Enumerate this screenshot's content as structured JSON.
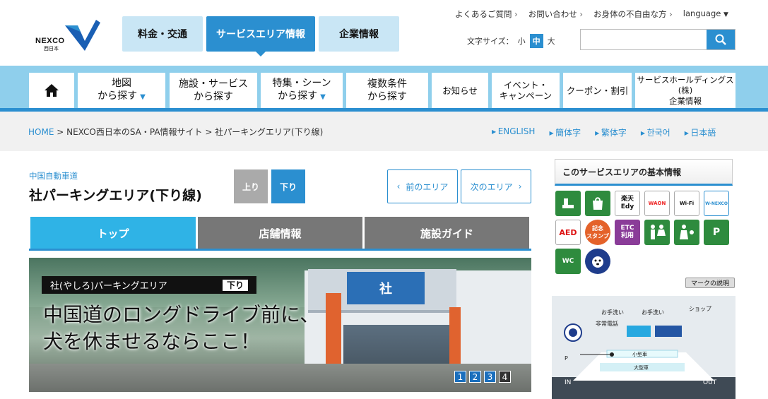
{
  "logo": {
    "brand": "NEXCO",
    "sub": "西日本"
  },
  "global_tabs": [
    "料金・交通",
    "サービスエリア情報",
    "企業情報"
  ],
  "utility_links": [
    "よくあるご質問",
    "お問い合わせ",
    "お身体の不自由な方"
  ],
  "language_label": "language",
  "font_size": {
    "label": "文字サイズ：",
    "small": "小",
    "medium": "中",
    "large": "大"
  },
  "search": {
    "placeholder": ""
  },
  "nav": {
    "map": [
      "地図",
      "から探す"
    ],
    "facility": [
      "施設・サービス",
      "から探す"
    ],
    "feature": [
      "特集・シーン",
      "から探す"
    ],
    "multi": [
      "複数条件",
      "から探す"
    ],
    "news": "お知らせ",
    "event": [
      "イベント・",
      "キャンペーン"
    ],
    "coupon": "クーポン・割引",
    "holdings": [
      "サービスホールディングス(株)",
      "企業情報"
    ]
  },
  "breadcrumb": {
    "home": "HOME",
    "site": "NEXCO西日本のSA・PA情報サイト",
    "current": "社パーキングエリア(下り線)",
    "sep": " > "
  },
  "languages": [
    "ENGLISH",
    "簡体字",
    "繁体字",
    "한국어",
    "日本語"
  ],
  "road": "中国自動車道",
  "title": "社パーキングエリア(下り線)",
  "direction": {
    "up": "上り",
    "down": "下り"
  },
  "area_nav": {
    "prev": "前のエリア",
    "next": "次のエリア"
  },
  "content_tabs": [
    "トップ",
    "店舗情報",
    "施設ガイド"
  ],
  "hero": {
    "name": "社(やしろ)パーキングエリア",
    "dir": "下り",
    "headline_1": "中国道のロングドライブ前に、",
    "headline_2": "犬を休ませるならここ！",
    "sign": "社",
    "pages": [
      "1",
      "2",
      "3",
      "4"
    ],
    "active_page": 4
  },
  "info": {
    "heading": "このサービスエリアの基本情報",
    "icons": [
      {
        "name": "restroom-icon",
        "text": ""
      },
      {
        "name": "shop-icon",
        "text": ""
      },
      {
        "name": "rakuten-edy-icon",
        "text": "楽天\nEdy"
      },
      {
        "name": "waon-icon",
        "text": "WAON"
      },
      {
        "name": "wifi-icon",
        "text": "Wi-Fi"
      },
      {
        "name": "nexco-wifi-icon",
        "text": "W-NEXCO"
      },
      {
        "name": "aed-icon",
        "text": "AED"
      },
      {
        "name": "stamp-icon",
        "text": "記念\nスタンプ"
      },
      {
        "name": "etc-icon",
        "text": "ETC\n利用"
      },
      {
        "name": "toilet-icon",
        "text": ""
      },
      {
        "name": "baby-room-icon",
        "text": ""
      },
      {
        "name": "accessible-parking-icon",
        "text": "P"
      },
      {
        "name": "accessible-toilet-icon",
        "text": "WC"
      },
      {
        "name": "dog-run-icon",
        "text": ""
      }
    ],
    "marks_btn": "マークの説明"
  },
  "map": {
    "toilet1": "お手洗い",
    "toilet2": "お手洗い",
    "shop": "ショップ",
    "phone": "非常電話",
    "small": "小型車",
    "large": "大型車",
    "in": "IN",
    "out": "OUT",
    "p": "P"
  },
  "colors": {
    "accent": "#2b8fd0",
    "nav_band": "#8fcfec",
    "tab_active": "#2fb3e6"
  }
}
